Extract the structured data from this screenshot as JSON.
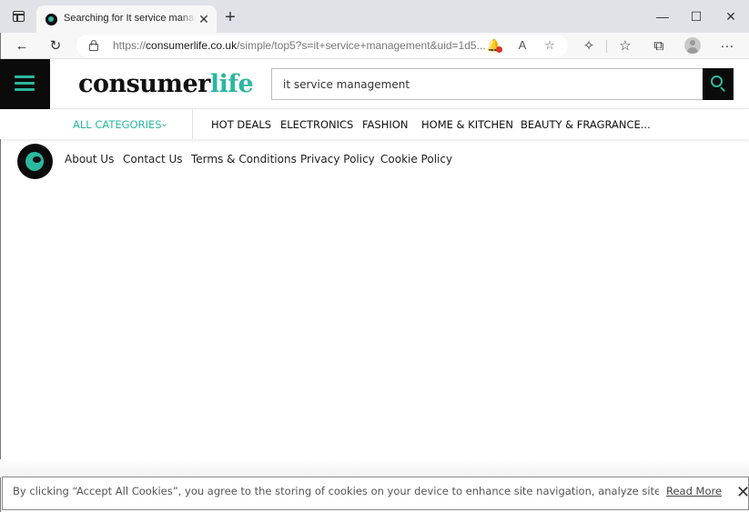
{
  "browser": {
    "tab_title": "Searching for It service management",
    "url_prefix": "https://",
    "url_host": "consumerlife.co.uk",
    "url_path": "/simple/top5?s=it+service+management&uid=1d5...",
    "icons": {
      "back": "←",
      "refresh": "↻",
      "close_tab": "✕",
      "new_tab": "+",
      "minimize": "—",
      "maximize": "☐",
      "close_window": "✕",
      "read_aloud": "A",
      "favorite_add": "☆",
      "extensions": "✧",
      "favorites": "☆",
      "collections": "⧉",
      "more": "···"
    }
  },
  "site": {
    "logo_main": "consumer",
    "logo_accent": "life",
    "search": {
      "value": "it service management",
      "placeholder": ""
    },
    "categories": {
      "all_label": "ALL CATEGORIES",
      "chevron": "⌄",
      "items": [
        "HOT DEALS",
        "ELECTRONICS",
        "FASHION",
        "HOME & KITCHEN",
        "BEAUTY & FRAGRANCE..."
      ]
    },
    "footer_links": [
      "About Us",
      "Contact Us",
      "Terms & Conditions",
      "Privacy Policy",
      "Cookie Policy"
    ]
  },
  "cookie_banner": {
    "text": "By clicking “Accept All Cookies”, you agree to the storing of cookies on your device to enhance site navigation, analyze site usage, a...",
    "read_more": "Read More",
    "close": "✕"
  },
  "colors": {
    "accent": "#2bb7a0",
    "dark": "#0b0b0b"
  }
}
